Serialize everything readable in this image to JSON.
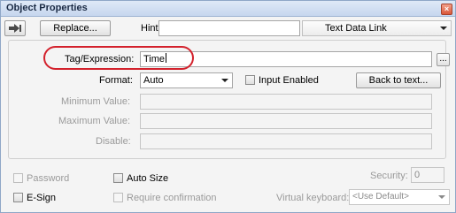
{
  "window": {
    "title": "Object Properties"
  },
  "toolbar": {
    "replace_label": "Replace...",
    "hint_label": "Hint:",
    "hint_value": "",
    "link_type": "Text Data Link"
  },
  "tag": {
    "label": "Tag/Expression:",
    "value": "Time",
    "browse_label": "..."
  },
  "format": {
    "label": "Format:",
    "value": "Auto"
  },
  "input_enabled": {
    "label": "Input Enabled",
    "checked": false
  },
  "back_to_text_label": "Back to text...",
  "minimum": {
    "label": "Minimum Value:",
    "value": ""
  },
  "maximum": {
    "label": "Maximum Value:",
    "value": ""
  },
  "disable": {
    "label": "Disable:",
    "value": ""
  },
  "options": {
    "password_label": "Password",
    "auto_size_label": "Auto Size",
    "esign_label": "E-Sign",
    "require_confirmation_label": "Require confirmation"
  },
  "security": {
    "label": "Security:",
    "value": "0"
  },
  "virtual_keyboard": {
    "label": "Virtual keyboard:",
    "value": "<Use Default>"
  },
  "colors": {
    "highlight": "#d3212c",
    "title_bg": "#c6d6ee"
  }
}
